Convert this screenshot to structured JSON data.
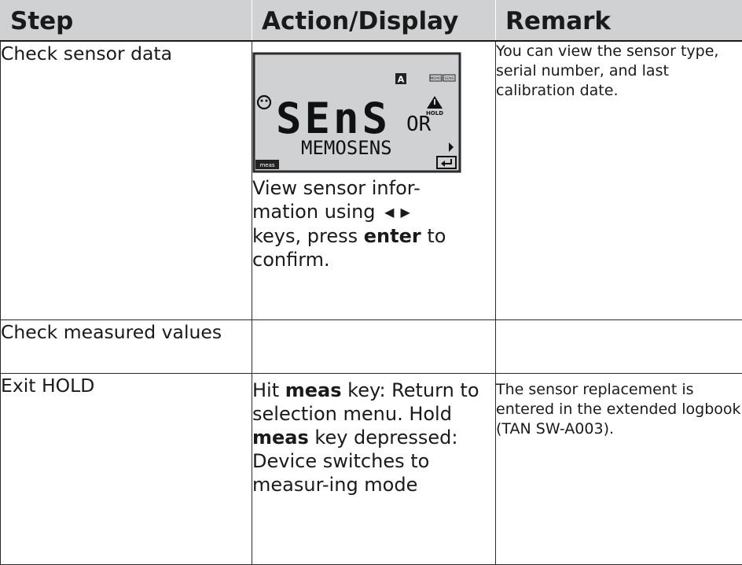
{
  "headers": {
    "step": "Step",
    "action": "Action/Display",
    "remark": "Remark"
  },
  "rows": [
    {
      "step": "Check sensor data",
      "action": {
        "line1": "View sensor infor-",
        "line2_pre": "mation using",
        "line3_pre": "keys, press",
        "line3_bold": "enter",
        "line3_post": "to",
        "line4": "confirm."
      },
      "remark": "You can view the sensor type, serial number, and last calibration date."
    },
    {
      "step": "Check measured values",
      "action": "",
      "remark": ""
    },
    {
      "step": "Exit HOLD",
      "action": {
        "pre1": "Hit",
        "bold1": "meas",
        "post1": "key: Return to selection menu. Hold",
        "bold2": "meas",
        "post2": "key depressed: Device switches to measur-ing mode"
      },
      "remark": "The sensor replacement is entered in the extended logbook (TAN SW-A003)."
    }
  ],
  "display": {
    "main_text": "SEnS",
    "small_text": "OR",
    "sub_text": "MEMOSENS",
    "indicator_a": "A",
    "hold_label": "HOLD",
    "meas_label": "meas",
    "memo_label": "MEMO",
    "sens_label": "SENS"
  },
  "icons": {
    "left_key": "left-triangle-icon",
    "right_key": "right-triangle-icon"
  }
}
